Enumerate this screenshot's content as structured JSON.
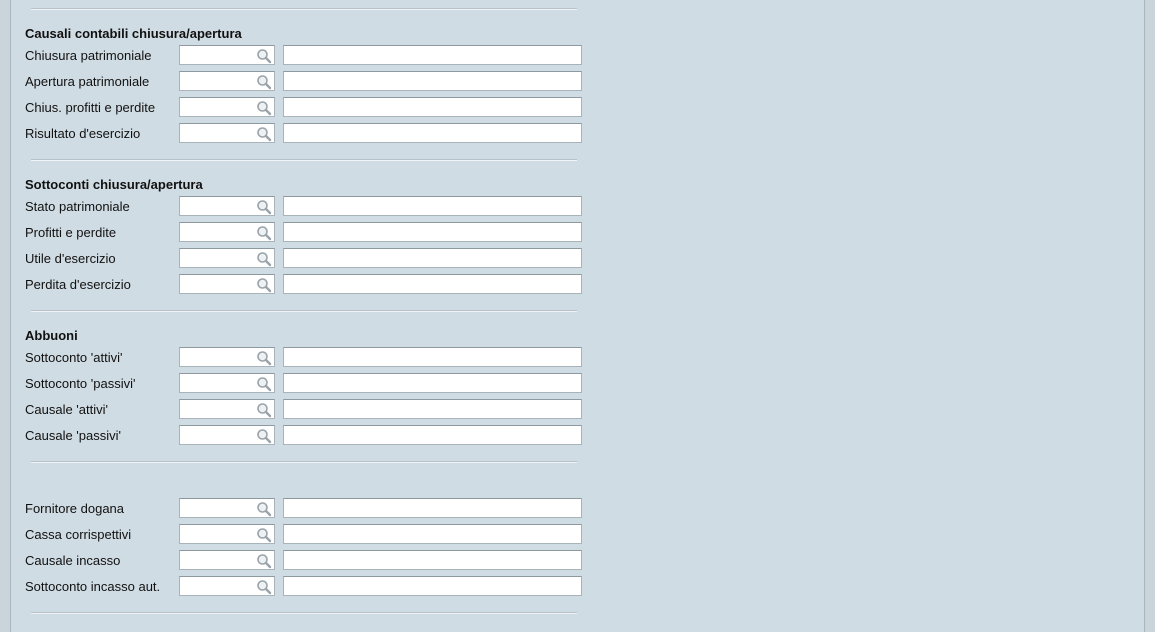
{
  "sections": [
    {
      "title": "Causali contabili chiusura/apertura",
      "rows": [
        {
          "label": "Chiusura patrimoniale",
          "code": "",
          "description": ""
        },
        {
          "label": "Apertura patrimoniale",
          "code": "",
          "description": ""
        },
        {
          "label": "Chius. profitti e perdite",
          "code": "",
          "description": ""
        },
        {
          "label": "Risultato d'esercizio",
          "code": "",
          "description": ""
        }
      ]
    },
    {
      "title": "Sottoconti chiusura/apertura",
      "rows": [
        {
          "label": "Stato patrimoniale",
          "code": "",
          "description": ""
        },
        {
          "label": "Profitti e perdite",
          "code": "",
          "description": ""
        },
        {
          "label": "Utile d'esercizio",
          "code": "",
          "description": ""
        },
        {
          "label": "Perdita d'esercizio",
          "code": "",
          "description": ""
        }
      ]
    },
    {
      "title": "Abbuoni",
      "rows": [
        {
          "label": "Sottoconto 'attivi'",
          "code": "",
          "description": ""
        },
        {
          "label": "Sottoconto 'passivi'",
          "code": "",
          "description": ""
        },
        {
          "label": "Causale 'attivi'",
          "code": "",
          "description": ""
        },
        {
          "label": "Causale 'passivi'",
          "code": "",
          "description": ""
        }
      ]
    },
    {
      "title": "",
      "rows": [
        {
          "label": "Fornitore dogana",
          "code": "",
          "description": ""
        },
        {
          "label": "Cassa corrispettivi",
          "code": "",
          "description": ""
        },
        {
          "label": "Causale incasso",
          "code": "",
          "description": ""
        },
        {
          "label": "Sottoconto incasso aut.",
          "code": "",
          "description": ""
        }
      ]
    }
  ],
  "icons": {
    "lookup": "magnifier-icon"
  },
  "colors": {
    "background": "#d0dce3",
    "field": "#ffffff",
    "separator": "#b6c1c8"
  }
}
